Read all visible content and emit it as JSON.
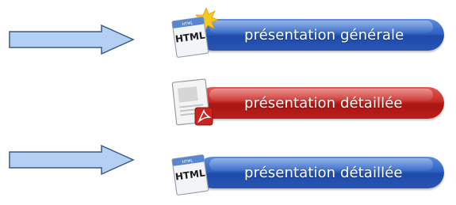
{
  "buttons": [
    {
      "label": "présentation générale",
      "icon": "html-document-icon",
      "theme": "blue",
      "icon_text": "HTML"
    },
    {
      "label": "présentation détaillée",
      "icon": "pdf-document-icon",
      "theme": "red"
    },
    {
      "label": "présentation détaillée",
      "icon": "html-document-icon",
      "theme": "blue",
      "icon_text": "HTML"
    }
  ],
  "arrows": [
    {
      "name": "pointer-arrow",
      "points_to": "présentation générale"
    },
    {
      "name": "pointer-arrow",
      "points_to": "présentation détaillée"
    }
  ],
  "colors": {
    "arrow_fill": "#b3cff2",
    "arrow_stroke": "#3c5a85",
    "blue_button": "#2f63c4",
    "red_button": "#c72b27"
  }
}
